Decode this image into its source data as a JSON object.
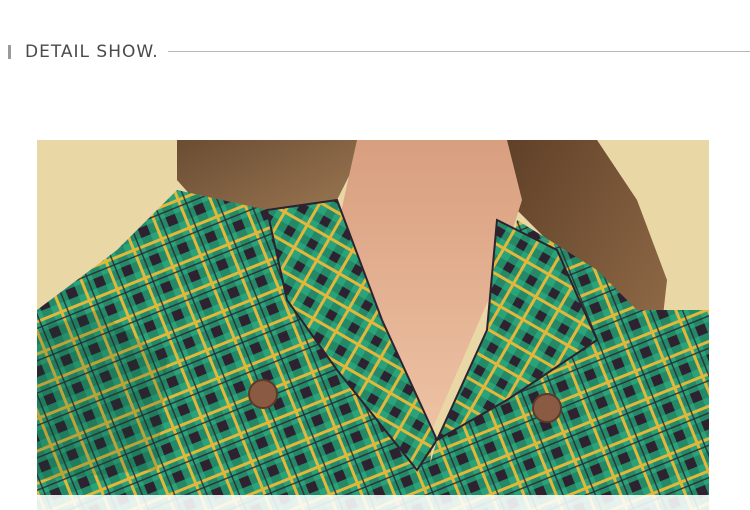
{
  "header": {
    "title": "DETAIL SHOW.",
    "accent_color": "#9a9a9a"
  },
  "photo": {
    "subject": "woman-in-green-plaid-double-breasted-jacket",
    "colors": {
      "background": "#e9d7a6",
      "plaid_base": "#2aa37a",
      "plaid_dark": "#2e2230",
      "plaid_yellow": "#e3b73a",
      "skin": "#e6b393",
      "hair": "#7a5534",
      "button": "#8a5a43"
    }
  }
}
